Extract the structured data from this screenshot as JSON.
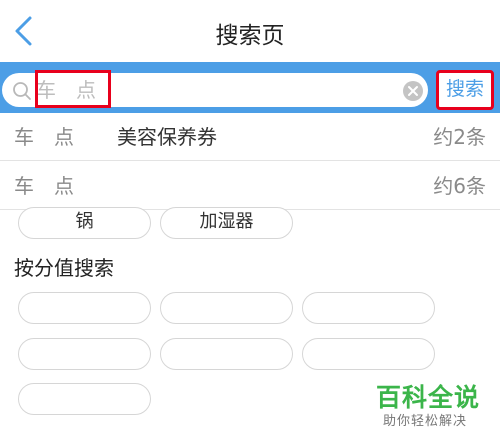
{
  "nav": {
    "title": "搜索页",
    "back_icon": "chevron-left-icon"
  },
  "search": {
    "query": "车　点",
    "button_label": "搜索",
    "search_icon": "search-icon",
    "clear_icon": "clear-icon"
  },
  "suggestions": [
    {
      "keyword": "车　点",
      "label": "美容保养券",
      "count": "约2条"
    },
    {
      "keyword": "车　点",
      "label": "",
      "count": "约6条"
    }
  ],
  "category_tags": [
    "锅",
    "加湿器"
  ],
  "value_section": {
    "title": "按分值搜索",
    "tags": [
      "",
      "",
      "",
      "",
      "",
      "",
      ""
    ]
  },
  "watermark": {
    "main": "百科全说",
    "sub": "助你轻松解决"
  },
  "colors": {
    "accent": "#4c9ee6",
    "highlight": "#e8001c",
    "watermark": "#3bb54a"
  }
}
